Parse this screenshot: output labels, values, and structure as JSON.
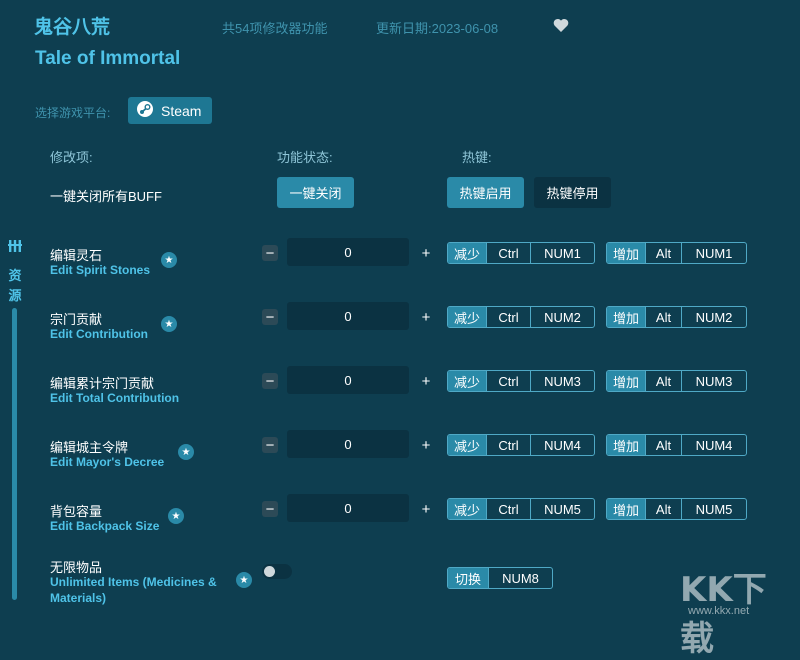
{
  "header": {
    "title_cn": "鬼谷八荒",
    "feature_count": "共54项修改器功能",
    "update_date": "更新日期:2023-06-08",
    "title_en": "Tale of Immortal"
  },
  "platform": {
    "label": "选择游戏平台:",
    "steam_label": "Steam"
  },
  "columns": {
    "item": "修改项:",
    "status": "功能状态:",
    "hotkey": "热键:"
  },
  "buff_row": {
    "label": "一键关闭所有BUFF",
    "action": "一键关闭",
    "hotkey_on": "热键启用",
    "hotkey_off": "热键停用"
  },
  "side_tab": {
    "label": "资源"
  },
  "rows": [
    {
      "cn": "编辑灵石",
      "en": "Edit Spirit Stones",
      "value": "0",
      "dec": [
        "减少",
        "Ctrl",
        "NUM1"
      ],
      "inc": [
        "增加",
        "Alt",
        "NUM1"
      ]
    },
    {
      "cn": "宗门贡献",
      "en": "Edit Contribution",
      "value": "0",
      "dec": [
        "减少",
        "Ctrl",
        "NUM2"
      ],
      "inc": [
        "增加",
        "Alt",
        "NUM2"
      ]
    },
    {
      "cn": "编辑累计宗门贡献",
      "en": "Edit Total Contribution",
      "value": "0",
      "dec": [
        "减少",
        "Ctrl",
        "NUM3"
      ],
      "inc": [
        "增加",
        "Alt",
        "NUM3"
      ]
    },
    {
      "cn": "编辑城主令牌",
      "en": "Edit Mayor's Decree",
      "value": "0",
      "dec": [
        "减少",
        "Ctrl",
        "NUM4"
      ],
      "inc": [
        "增加",
        "Alt",
        "NUM4"
      ]
    },
    {
      "cn": "背包容量",
      "en": "Edit Backpack Size",
      "value": "0",
      "dec": [
        "减少",
        "Ctrl",
        "NUM5"
      ],
      "inc": [
        "增加",
        "Alt",
        "NUM5"
      ]
    }
  ],
  "unlimited": {
    "cn": "无限物品",
    "en_line1": "Unlimited Items (Medicines &",
    "en_line2": "Materials)",
    "hotkey": [
      "切换",
      "NUM8"
    ]
  },
  "controls": {
    "minus": "−",
    "plus": "+"
  },
  "watermark": {
    "text": "KK下载",
    "url": "www.kkx.net"
  },
  "colors": {
    "background": "#0e3e50",
    "accent": "#4fc3e8",
    "button": "#2a8aa8",
    "field": "#0b3242"
  }
}
